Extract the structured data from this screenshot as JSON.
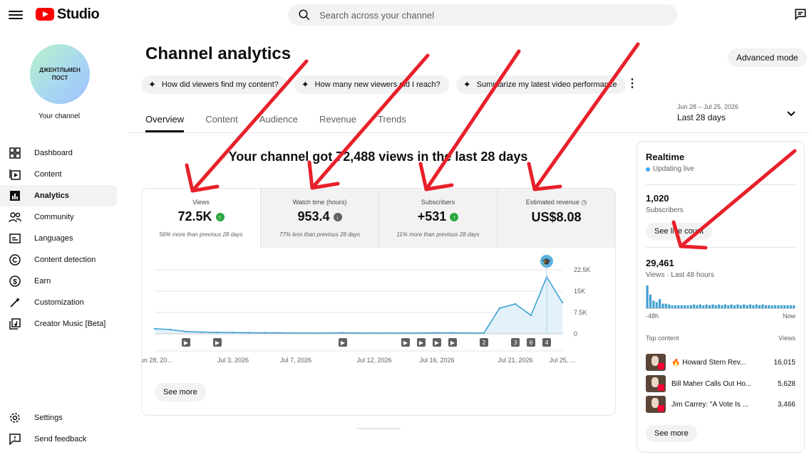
{
  "app": {
    "brand": "Studio"
  },
  "search": {
    "placeholder": "Search across your channel"
  },
  "channel": {
    "avatar_text": "ДЖЕНТЛЬМЕН ПОСТ",
    "label": "Your channel"
  },
  "sidebar": {
    "items": [
      {
        "label": "Dashboard",
        "icon": "dashboard-icon"
      },
      {
        "label": "Content",
        "icon": "content-icon"
      },
      {
        "label": "Analytics",
        "icon": "analytics-icon",
        "active": true
      },
      {
        "label": "Community",
        "icon": "community-icon"
      },
      {
        "label": "Languages",
        "icon": "languages-icon"
      },
      {
        "label": "Content detection",
        "icon": "copyright-icon"
      },
      {
        "label": "Earn",
        "icon": "dollar-icon"
      },
      {
        "label": "Customization",
        "icon": "magic-wand-icon"
      },
      {
        "label": "Creator Music [Beta]",
        "icon": "music-icon"
      }
    ],
    "bottom": [
      {
        "label": "Settings",
        "icon": "gear-icon"
      },
      {
        "label": "Send feedback",
        "icon": "feedback-icon"
      }
    ]
  },
  "page": {
    "title": "Channel analytics",
    "advanced_mode": "Advanced mode",
    "chips": [
      "How did viewers find my content?",
      "How many new viewers did I reach?",
      "Summarize my latest video performance"
    ],
    "tabs": [
      "Overview",
      "Content",
      "Audience",
      "Revenue",
      "Trends"
    ],
    "date_range": {
      "dates": "Jun 28 – Jul 25, 2026",
      "label": "Last 28 days"
    },
    "headline": "Your channel got 72,488 views in the last 28 days"
  },
  "metrics": [
    {
      "label": "Views",
      "value": "72.5K",
      "trend": "up",
      "compare": "56% more than previous 28 days"
    },
    {
      "label": "Watch time (hours)",
      "value": "953.4",
      "trend": "down",
      "compare": "77% less than previous 28 days"
    },
    {
      "label": "Subscribers",
      "value": "+531",
      "trend": "up",
      "compare": "11% more than previous 28 days"
    },
    {
      "label": "Estimated revenue",
      "value": "US$8.08",
      "trend": "none",
      "compare": ""
    }
  ],
  "chart_data": {
    "type": "area",
    "series": [
      {
        "name": "Views",
        "color": "#3fa0d0",
        "values": [
          1800,
          1500,
          800,
          600,
          500,
          450,
          400,
          350,
          350,
          300,
          300,
          300,
          350,
          300,
          300,
          300,
          300,
          300,
          350,
          350,
          300,
          300,
          9000,
          10500,
          6500,
          20000,
          11000
        ]
      }
    ],
    "x_ticks": [
      "Jun 28, 20...",
      "Jul 3, 2026",
      "Jul 7, 2026",
      "Jul 12, 2026",
      "Jul 16, 2026",
      "Jul 21, 2026",
      "Jul 25, ..."
    ],
    "x_tick_index": [
      0,
      5,
      9,
      14,
      18,
      23,
      26
    ],
    "y_ticks": [
      "22.5K",
      "15K",
      "7.5K",
      "0"
    ],
    "ylim": [
      0,
      22500
    ],
    "markers": [
      {
        "index": 2,
        "label": "▶"
      },
      {
        "index": 4,
        "label": "▶"
      },
      {
        "index": 12,
        "label": "▶"
      },
      {
        "index": 16,
        "label": "▶"
      },
      {
        "index": 17,
        "label": "▶"
      },
      {
        "index": 18,
        "label": "▶"
      },
      {
        "index": 19,
        "label": "▶"
      },
      {
        "index": 21,
        "label": "2"
      },
      {
        "index": 23,
        "label": "3"
      },
      {
        "index": 24,
        "label": "6"
      },
      {
        "index": 25,
        "label": "4"
      }
    ]
  },
  "chart_see_more": "See more",
  "realtime": {
    "title": "Realtime",
    "status": "Updating live",
    "subscribers": "1,020",
    "subscribers_label": "Subscribers",
    "live_count_button": "See live count",
    "views": "29,461",
    "views_label": "Views · Last 48 hours",
    "spark_start": "-48h",
    "spark_end": "Now",
    "spark_values": [
      30,
      18,
      10,
      8,
      12,
      6,
      6,
      5,
      4,
      4,
      4,
      4,
      4,
      4,
      4,
      5,
      4,
      5,
      4,
      5,
      4,
      5,
      4,
      5,
      4,
      5,
      4,
      5,
      4,
      5,
      4,
      5,
      4,
      5,
      4,
      5,
      4,
      5,
      4,
      4,
      4,
      4,
      4,
      4,
      4,
      4,
      4,
      4
    ],
    "top_content_label": "Top content",
    "views_col_label": "Views",
    "top": [
      {
        "title": "🔥 Howard Stern Rev...",
        "views": "16,015"
      },
      {
        "title": "Bill Maher Calls Out Ho...",
        "views": "5,628"
      },
      {
        "title": "Jim Carrey: \"A Vote Is ...",
        "views": "3,466"
      }
    ],
    "see_more": "See more"
  }
}
